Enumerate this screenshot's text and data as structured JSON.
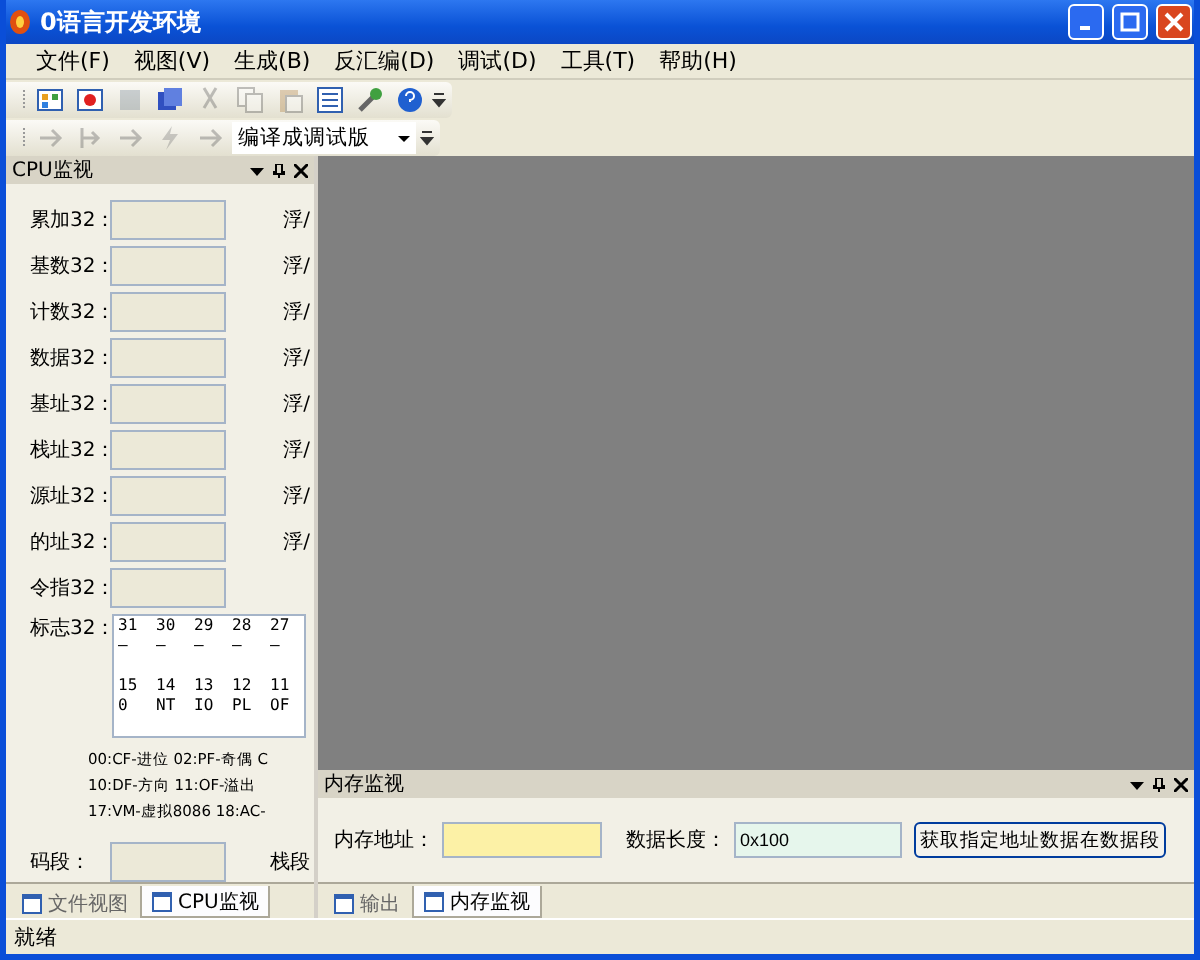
{
  "window": {
    "title": "0语言开发环境"
  },
  "menu": [
    "文件(F)",
    "视图(V)",
    "生成(B)",
    "反汇编(D)",
    "调试(D)",
    "工具(T)",
    "帮助(H)"
  ],
  "toolbar_1": [
    {
      "kind": "grid",
      "disabled": false
    },
    {
      "kind": "image",
      "disabled": false
    },
    {
      "kind": "save",
      "disabled": true
    },
    {
      "kind": "saveall",
      "disabled": false
    },
    {
      "kind": "cut",
      "disabled": true
    },
    {
      "kind": "copy",
      "disabled": true
    },
    {
      "kind": "paste",
      "disabled": true
    },
    {
      "kind": "list",
      "disabled": false
    },
    {
      "kind": "tools",
      "disabled": false
    },
    {
      "kind": "help",
      "disabled": false
    }
  ],
  "toolbar_2": {
    "buttons": [
      {
        "kind": "arrow",
        "disabled": true
      },
      {
        "kind": "step",
        "disabled": true
      },
      {
        "kind": "arrow",
        "disabled": true
      },
      {
        "kind": "bolt",
        "disabled": true
      },
      {
        "kind": "arrow",
        "disabled": true
      }
    ],
    "build_mode": "编译成调试版"
  },
  "cpu_panel": {
    "title": "CPU监视",
    "registers": [
      {
        "label": "累加32：",
        "side": "浮/"
      },
      {
        "label": "基数32：",
        "side": "浮/"
      },
      {
        "label": "计数32：",
        "side": "浮/"
      },
      {
        "label": "数据32：",
        "side": "浮/"
      },
      {
        "label": "基址32：",
        "side": "浮/"
      },
      {
        "label": "栈址32：",
        "side": "浮/"
      },
      {
        "label": "源址32：",
        "side": "浮/"
      },
      {
        "label": "的址32：",
        "side": "浮/"
      },
      {
        "label": "令指32："
      }
    ],
    "flags_label": "标志32：",
    "flags_rows": [
      [
        "31",
        "30",
        "29",
        "28",
        "27"
      ],
      [
        "—",
        "—",
        "—",
        "—",
        "—"
      ],
      [
        "15",
        "14",
        "13",
        "12",
        "11"
      ],
      [
        "0",
        "NT",
        "IO",
        "PL",
        "OF"
      ]
    ],
    "legend": [
      "00:CF-进位 02:PF-奇偶 C",
      "10:DF-方向 11:OF-溢出",
      "17:VM-虚拟8086 18:AC-"
    ],
    "segment_label": "码段：",
    "segment_side": "栈段",
    "tabs": [
      {
        "label": "文件视图",
        "selected": false
      },
      {
        "label": "CPU监视",
        "selected": true
      }
    ]
  },
  "memory_panel": {
    "title": "内存监视",
    "address_label": "内存地址：",
    "length_label": "数据长度：",
    "length_value": "0x100",
    "fetch_button": "获取指定地址数据在数据段",
    "tabs": [
      {
        "label": "输出",
        "selected": false
      },
      {
        "label": "内存监视",
        "selected": true
      }
    ]
  },
  "status_bar": "就绪"
}
